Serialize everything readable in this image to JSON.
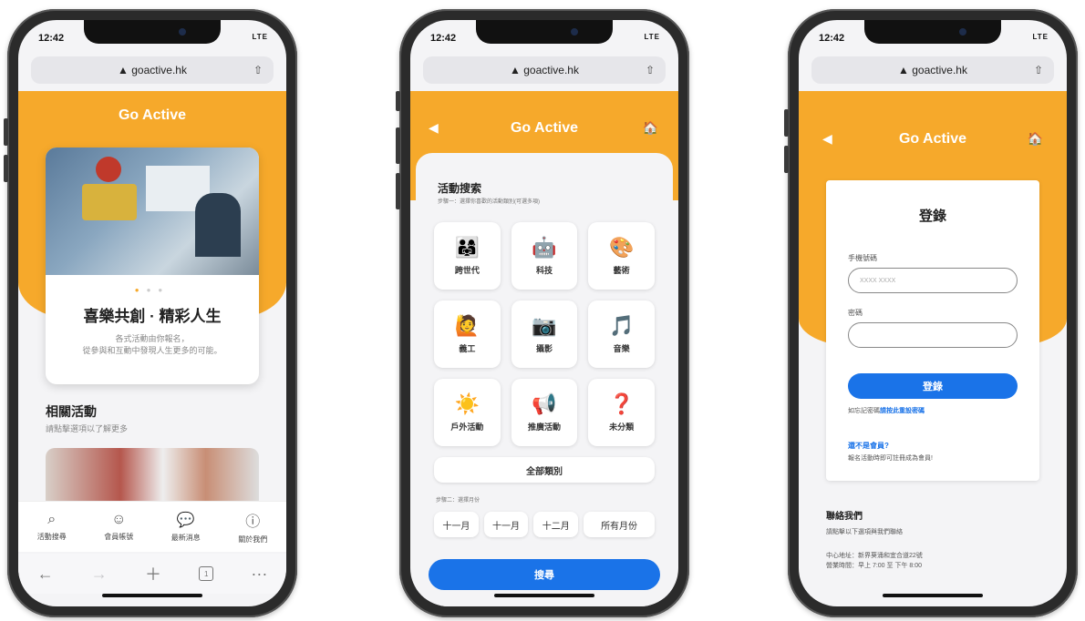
{
  "status": {
    "time": "12:42",
    "signal": "LTE"
  },
  "browser": {
    "url": "▲ goactive.hk",
    "share_icon": "share-icon"
  },
  "app": {
    "title": "Go Active",
    "back_icon": "◀",
    "home_icon": "🏠"
  },
  "phone1": {
    "carousel_dots": "● ● ●",
    "hero_title": "喜樂共創 · 精彩人生",
    "hero_sub_1": "各式活動由你報名，",
    "hero_sub_2": "從參與和互動中發現人生更多的可能。",
    "section_title": "相關活動",
    "section_sub": "請點擊選項以了解更多",
    "tabs": [
      {
        "icon": "⌕",
        "label": "活動搜尋"
      },
      {
        "icon": "☺",
        "label": "會員帳號"
      },
      {
        "icon": "💬",
        "label": "最新消息"
      },
      {
        "icon": "ⓘ",
        "label": "關於我們"
      }
    ],
    "safari": {
      "back": "←",
      "forward": "→",
      "add": "＋",
      "tabs": "1",
      "more": "···"
    }
  },
  "phone2": {
    "title": "活動搜索",
    "step1": "步驟一：選擇你喜歡的活動類別(可選多項)",
    "categories": [
      {
        "icon": "👨‍👩‍👧",
        "label": "跨世代"
      },
      {
        "icon": "🤖",
        "label": "科技"
      },
      {
        "icon": "🎨",
        "label": "藝術"
      },
      {
        "icon": "🙋",
        "label": "義工"
      },
      {
        "icon": "📷",
        "label": "攝影"
      },
      {
        "icon": "🎵",
        "label": "音樂"
      },
      {
        "icon": "☀️",
        "label": "戶外活動"
      },
      {
        "icon": "📢",
        "label": "推廣活動"
      },
      {
        "icon": "❓",
        "label": "未分類"
      }
    ],
    "all_label": "全部類別",
    "step2": "步驟二：選擇月份",
    "months": [
      "十一月",
      "十一月",
      "十二月",
      "所有月份"
    ],
    "search_label": "搜尋"
  },
  "phone3": {
    "card_title": "登錄",
    "phone_label": "手機號碼",
    "phone_placeholder": "XXXX XXXX",
    "password_label": "密碼",
    "login_label": "登錄",
    "forgot_text": "如忘記密碼",
    "forgot_link": "請按此重設密碼",
    "not_member": "還不是會員?",
    "not_member_sub": "報名活動時即可註冊成為會員!",
    "contact_title": "聯絡我們",
    "contact_sub": "請點擊以下選項與我們聯絡",
    "address": "中心地址：新界葵涌和宜合道22號",
    "hours": "營業時間：早上 7:00 至 下午 8:00"
  },
  "colors": {
    "brand_orange": "#f6a92b",
    "primary_blue": "#1a73e8"
  }
}
